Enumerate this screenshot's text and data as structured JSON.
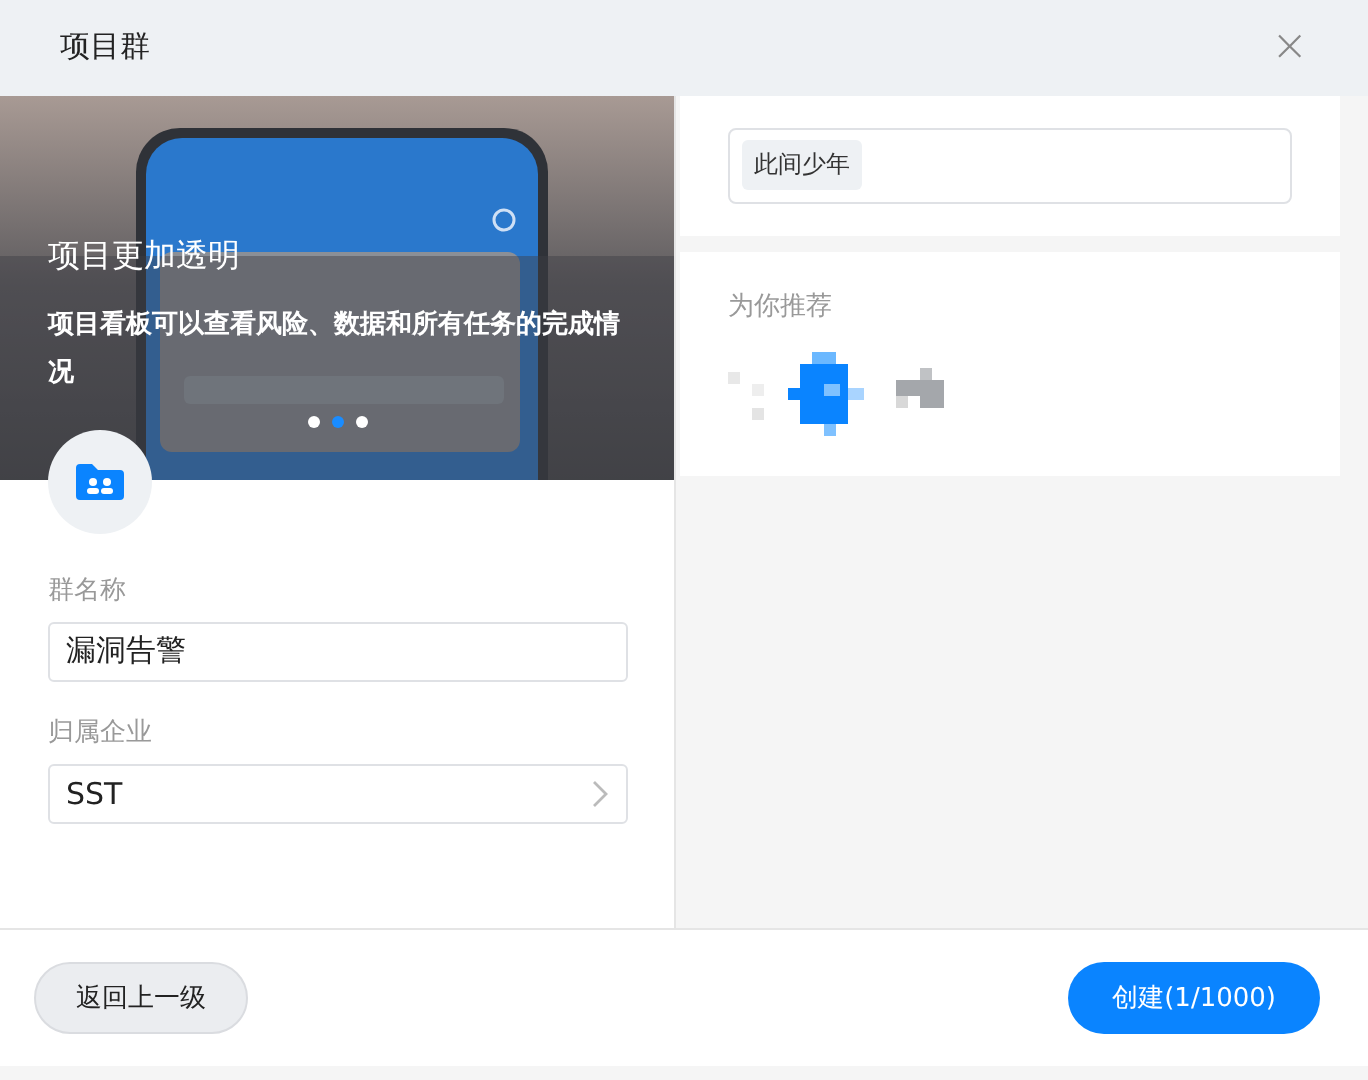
{
  "window": {
    "title": "项目群",
    "close": "×"
  },
  "banner": {
    "title": "项目更加透明",
    "description": "项目看板可以查看风险、数据和所有任务的完成情况",
    "dots": [
      {
        "selected": false
      },
      {
        "selected": true
      },
      {
        "selected": false
      }
    ]
  },
  "fields": [
    {
      "kind": "text",
      "label": "群名称",
      "value": "漏洞告警"
    },
    {
      "kind": "select",
      "label": "归属企业",
      "value": "SST"
    }
  ],
  "members": {
    "tags": [
      "此间少年"
    ]
  },
  "recommend": {
    "title": "为你推荐"
  },
  "buttons": [
    {
      "kind": "secondary",
      "label": "返回上一级"
    },
    {
      "kind": "primary",
      "label": "创建(1/1000)"
    }
  ]
}
